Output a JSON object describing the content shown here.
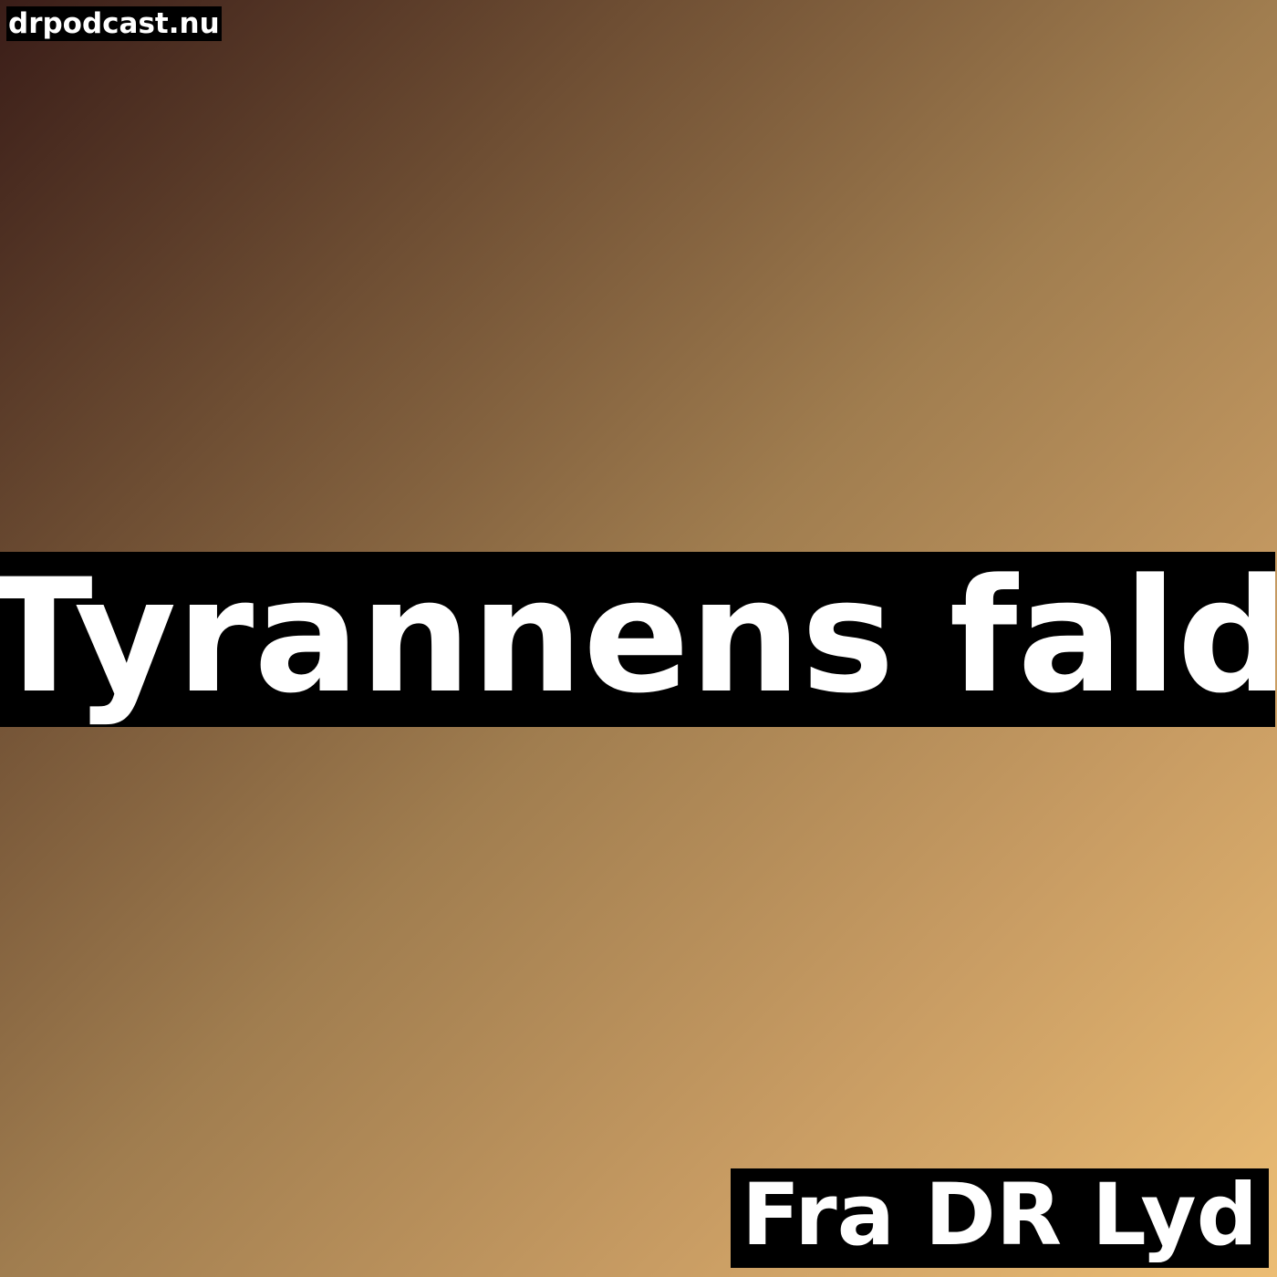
{
  "cover": {
    "site_label": "drpodcast.nu",
    "title": "Tyrannens fald",
    "source_label": "Fra DR Lyd"
  },
  "colors": {
    "gradient_start": "#3a1d18",
    "gradient_end": "#ecbd74",
    "label_background": "#000000",
    "text": "#ffffff"
  }
}
